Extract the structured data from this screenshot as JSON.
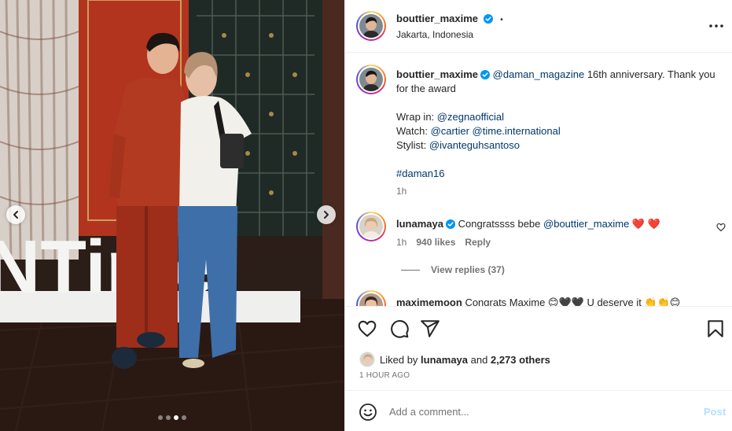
{
  "post": {
    "author": "bouttier_maxime",
    "location": "Jakarta, Indonesia",
    "header_dot": "•",
    "caption": {
      "mention_magazine": "@daman_magazine",
      "line1_rest": " 16th anniversary. Thank you for the award",
      "wrap_label": "Wrap in: ",
      "wrap_mention": "@zegnaofficial",
      "watch_label": "Watch: ",
      "watch_mention1": "@cartier",
      "watch_mention2": "@time.international",
      "stylist_label": "Stylist: ",
      "stylist_mention": "@ivanteguhsantoso",
      "hashtag": "#daman16",
      "time": "1h"
    },
    "comments": [
      {
        "user": "lunamaya",
        "text_before": "Congratssss bebe ",
        "mention": "@bouttier_maxime",
        "emoji": " ❤️ ❤️",
        "time": "1h",
        "likes": "940 likes",
        "reply_label": "Reply",
        "view_replies": "View replies (37)"
      },
      {
        "user": "maximemoon",
        "text": "Congrats Maxime 😊🖤🖤 U deserve it 👏👏😊"
      }
    ],
    "liked_by_prefix": "Liked by ",
    "liked_by_user": "lunamaya",
    "liked_by_and": " and ",
    "liked_by_others": "2,273 others",
    "time_ago": "1 HOUR AGO",
    "add_comment_placeholder": "Add a comment...",
    "post_button": "Post"
  },
  "carousel": {
    "slide_count": 4,
    "active_index": 2
  },
  "photo_sign_text": "NTime",
  "colors": {
    "accent": "#0095f6",
    "post_disabled": "#b2dffc",
    "mention": "#00376b",
    "heart": "#ed4956"
  },
  "icons": [
    "verified-badge-icon",
    "more-options-icon",
    "heart-icon",
    "comment-icon",
    "share-icon",
    "bookmark-icon",
    "emoji-icon",
    "chevron-left-icon",
    "chevron-right-icon"
  ]
}
